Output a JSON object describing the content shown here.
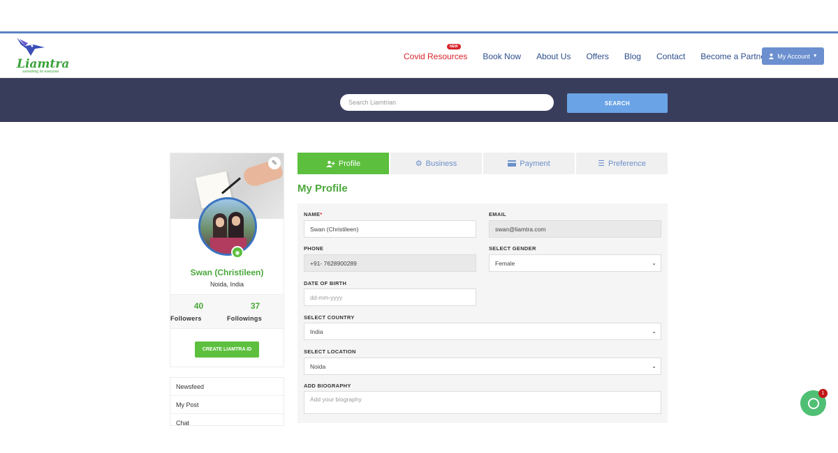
{
  "header": {
    "logo_text": "Liamtra",
    "logo_tagline": "something for everyone",
    "nav": {
      "covid": "Covid Resources",
      "new_badge": "NEW",
      "book": "Book Now",
      "about": "About Us",
      "offers": "Offers",
      "blog": "Blog",
      "contact": "Contact",
      "partner": "Become a Partner"
    },
    "account_label": "My Account"
  },
  "search": {
    "placeholder": "Search Liamtrian",
    "button": "SEARCH"
  },
  "profile_card": {
    "name": "Swan (Christileen)",
    "location": "Noida, India",
    "followers_count": "40",
    "followers_label": "Followers",
    "followings_count": "37",
    "followings_label": "Followings",
    "create_button": "CREATE LIAMTRA ID"
  },
  "side_menu": [
    "Newsfeed",
    "My Post",
    "Chat"
  ],
  "tabs": {
    "profile": "Profile",
    "business": "Business",
    "payment": "Payment",
    "preference": "Preference"
  },
  "page_title": "My Profile",
  "form": {
    "name_label": "NAME",
    "name_required": "*",
    "name_value": "Swan (Christileen)",
    "email_label": "EMAIL",
    "email_value": "swan@liamtra.com",
    "phone_label": "PHONE",
    "phone_value": "+91- 7628900289",
    "gender_label": "SELECT GENDER",
    "gender_value": "Female",
    "dob_label": "DATE OF BIRTH",
    "dob_placeholder": "dd-mm-yyyy",
    "country_label": "SELECT COUNTRY",
    "country_value": "India",
    "location_label": "SELECT LOCATION",
    "location_value": "Noida",
    "bio_label": "ADD BIOGRAPHY",
    "bio_placeholder": "Add your biography"
  },
  "chat": {
    "badge": "1"
  },
  "colors": {
    "brand_green": "#5cbf3e",
    "nav_blue": "#2d4e8c",
    "band": "#393d5c",
    "covid_red": "#d8232a"
  }
}
